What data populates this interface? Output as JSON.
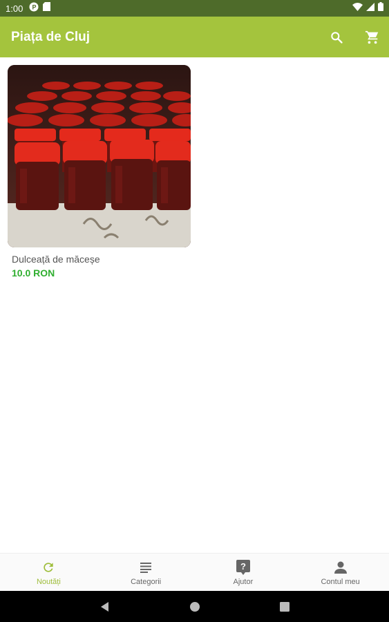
{
  "status_bar": {
    "time": "1:00",
    "left_icons": [
      "p-notification-icon",
      "sd-card-icon"
    ],
    "right_icons": [
      "wifi-icon",
      "signal-icon",
      "battery-icon"
    ]
  },
  "app_bar": {
    "title": "Piața de Cluj",
    "actions": [
      "search-icon",
      "cart-icon"
    ],
    "color": "#a4c43d"
  },
  "products": [
    {
      "name": "Dulceață de măceșe",
      "price": "10.0 RON"
    }
  ],
  "bottom_nav": {
    "items": [
      {
        "label": "Noutăți",
        "icon": "refresh-icon",
        "active": true
      },
      {
        "label": "Categorii",
        "icon": "list-icon",
        "active": false
      },
      {
        "label": "Ajutor",
        "icon": "help-icon",
        "active": false
      },
      {
        "label": "Contul meu",
        "icon": "account-icon",
        "active": false
      }
    ],
    "active_color": "#9ebd3a"
  },
  "system_nav": [
    "back-icon",
    "home-icon",
    "recents-icon"
  ]
}
